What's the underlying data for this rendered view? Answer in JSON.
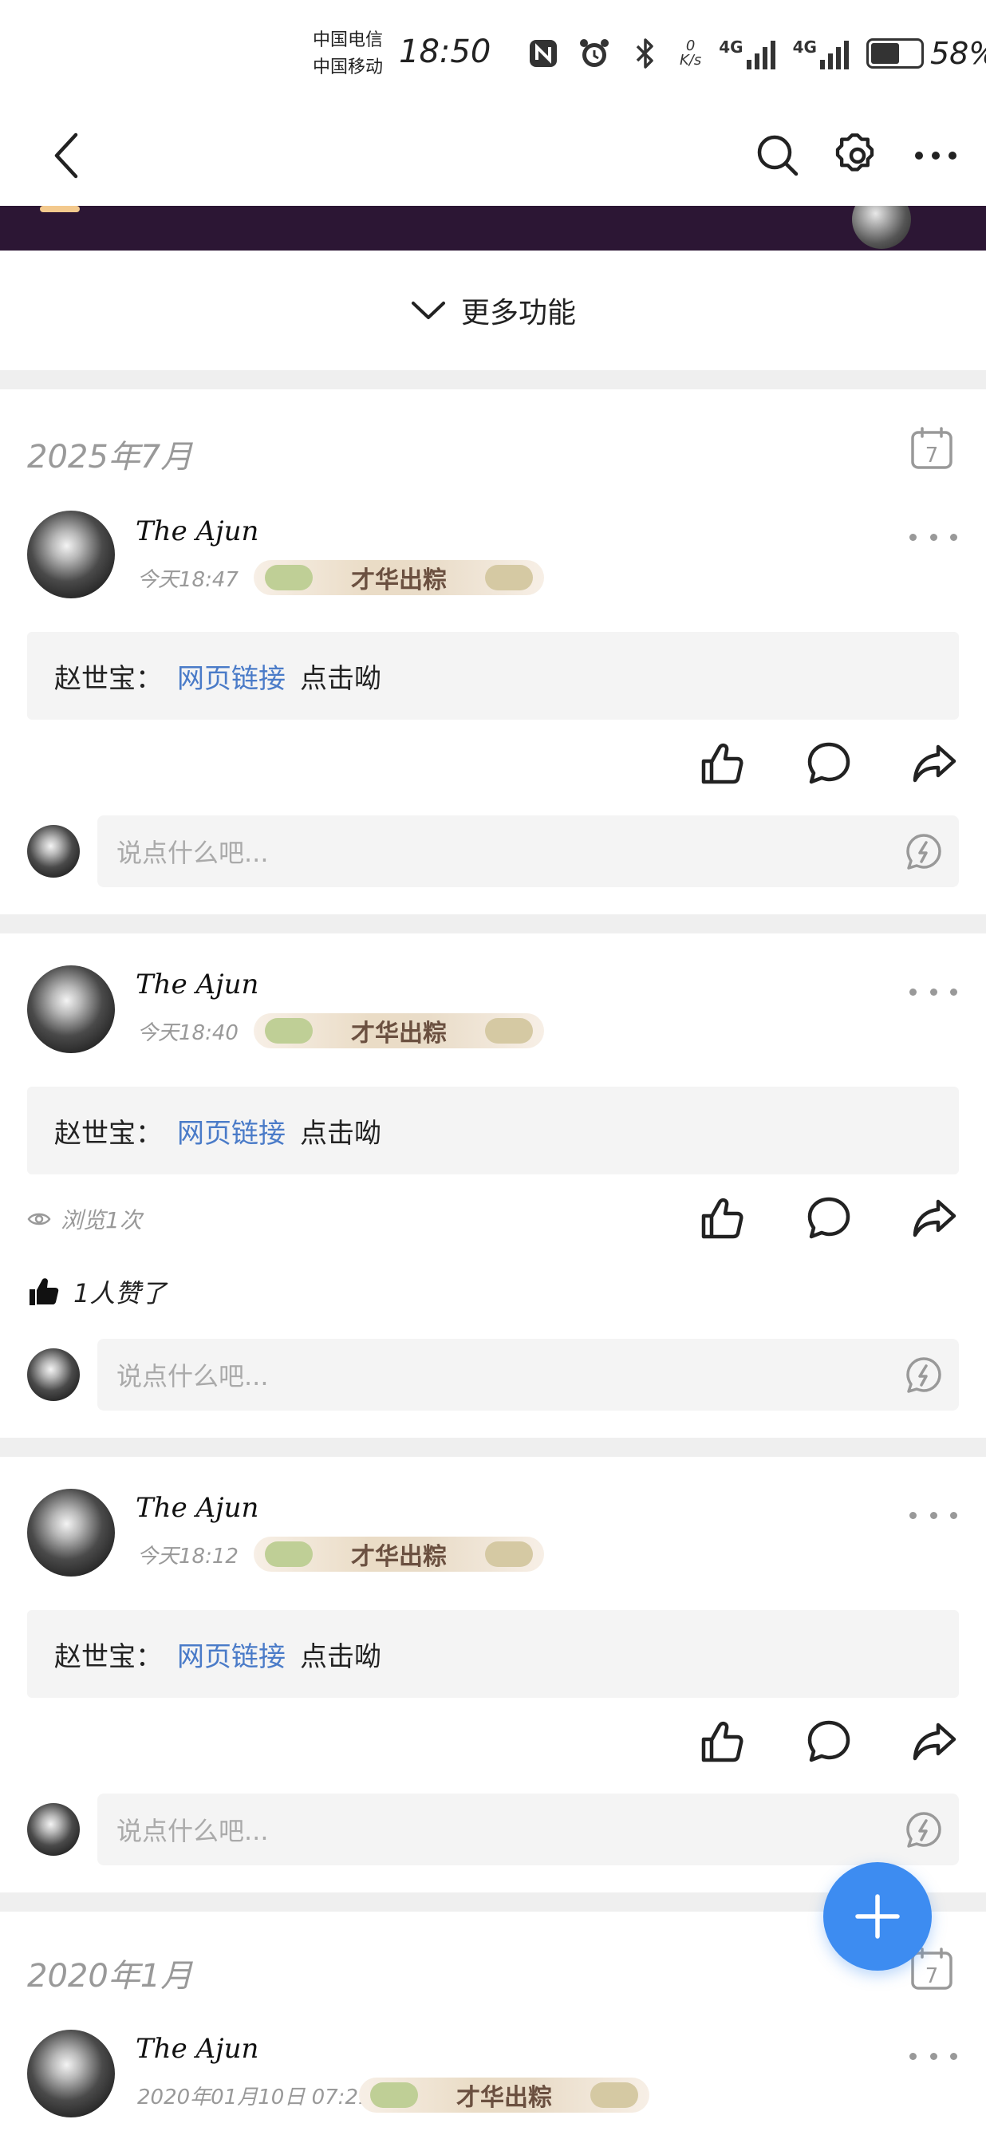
{
  "status_bar": {
    "carrier_1": "中国电信",
    "carrier_2": "中国移动",
    "time": "18:50",
    "net_speed_value": "0",
    "net_speed_unit": "K/s",
    "signal_1_label": "4G",
    "signal_2_label": "4G",
    "battery_percent": "58%",
    "battery_level": 0.58,
    "icons": [
      "nfc-icon",
      "alarm-icon",
      "bluetooth-icon"
    ]
  },
  "nav": {
    "icons": [
      "back-icon",
      "search-icon",
      "gear-icon",
      "more-icon"
    ]
  },
  "more_functions": {
    "label": "更多功能"
  },
  "feed": {
    "sections": [
      {
        "date": "2025年7月"
      },
      {
        "date": "2020年1月"
      }
    ],
    "posts": [
      {
        "author": "The Ajun",
        "time": "今天18:47",
        "badge": "才华出粽",
        "content_prefix": "赵世宝：",
        "content_link": "网页链接",
        "content_suffix": "点击呦",
        "comment_placeholder": "说点什么吧..."
      },
      {
        "author": "The Ajun",
        "time": "今天18:40",
        "badge": "才华出粽",
        "content_prefix": "赵世宝：",
        "content_link": "网页链接",
        "content_suffix": "点击呦",
        "views": "浏览1次",
        "likes": "1人赞了",
        "comment_placeholder": "说点什么吧..."
      },
      {
        "author": "The Ajun",
        "time": "今天18:12",
        "badge": "才华出粽",
        "content_prefix": "赵世宝：",
        "content_link": "网页链接",
        "content_suffix": "点击呦",
        "comment_placeholder": "说点什么吧..."
      },
      {
        "author": "The Ajun",
        "time": "2020年01月10日 07:21",
        "badge": "才华出粽"
      }
    ]
  },
  "fab": {
    "icon": "plus-icon",
    "color": "#3d8cf1"
  },
  "colors": {
    "link": "#4a7bc8",
    "banner": "#2c1634",
    "muted": "#999999"
  }
}
